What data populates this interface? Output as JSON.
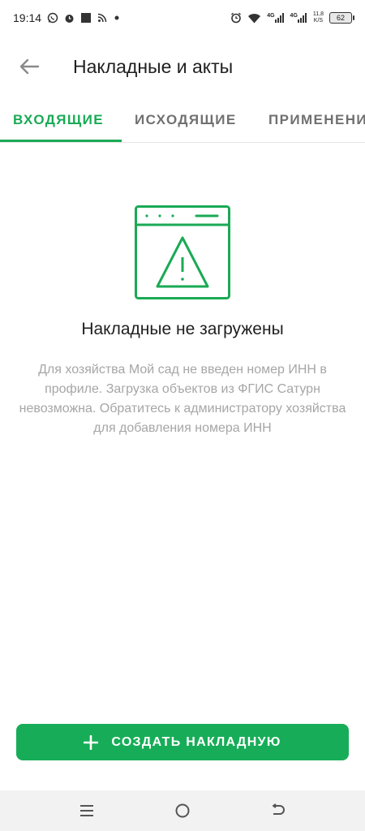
{
  "status_bar": {
    "time": "19:14",
    "network_left": "4G",
    "network_right": "4G",
    "speed_value": "11,8",
    "speed_unit": "K/S",
    "battery": "62",
    "left_icons": [
      "whatsapp-icon",
      "alarm-icon",
      "square-notification-icon",
      "rss-icon",
      "dot-icon"
    ],
    "right_icons": [
      "alarm-icon",
      "wifi-icon",
      "signal-icon",
      "signal-icon"
    ]
  },
  "header": {
    "title": "Накладные и акты",
    "back_icon": "arrow-left-icon"
  },
  "tabs": [
    {
      "label": "ВХОДЯЩИЕ",
      "active": true
    },
    {
      "label": "ИСХОДЯЩИЕ",
      "active": false
    },
    {
      "label": "ПРИМЕНЕНИЯ",
      "active": false
    }
  ],
  "empty_state": {
    "icon": "browser-warning-icon",
    "title": "Накладные не загружены",
    "description": "Для хозяйства Мой сад не введен номер ИНН в профиле. Загрузка объектов из ФГИС Сатурн невозможна. Обратитесь к администратору хозяйства для добавления номера ИНН"
  },
  "create_button": {
    "label": "СОЗДАТЬ НАКЛАДНУЮ",
    "icon": "plus-icon"
  },
  "nav_bar": {
    "buttons": [
      "menu-icon",
      "home-icon",
      "back-icon"
    ]
  },
  "colors": {
    "accent": "#1aaa55",
    "button": "#17ad58",
    "text_primary": "#1f1f1f",
    "text_secondary": "#a6a6a6",
    "tab_inactive": "#707070"
  }
}
